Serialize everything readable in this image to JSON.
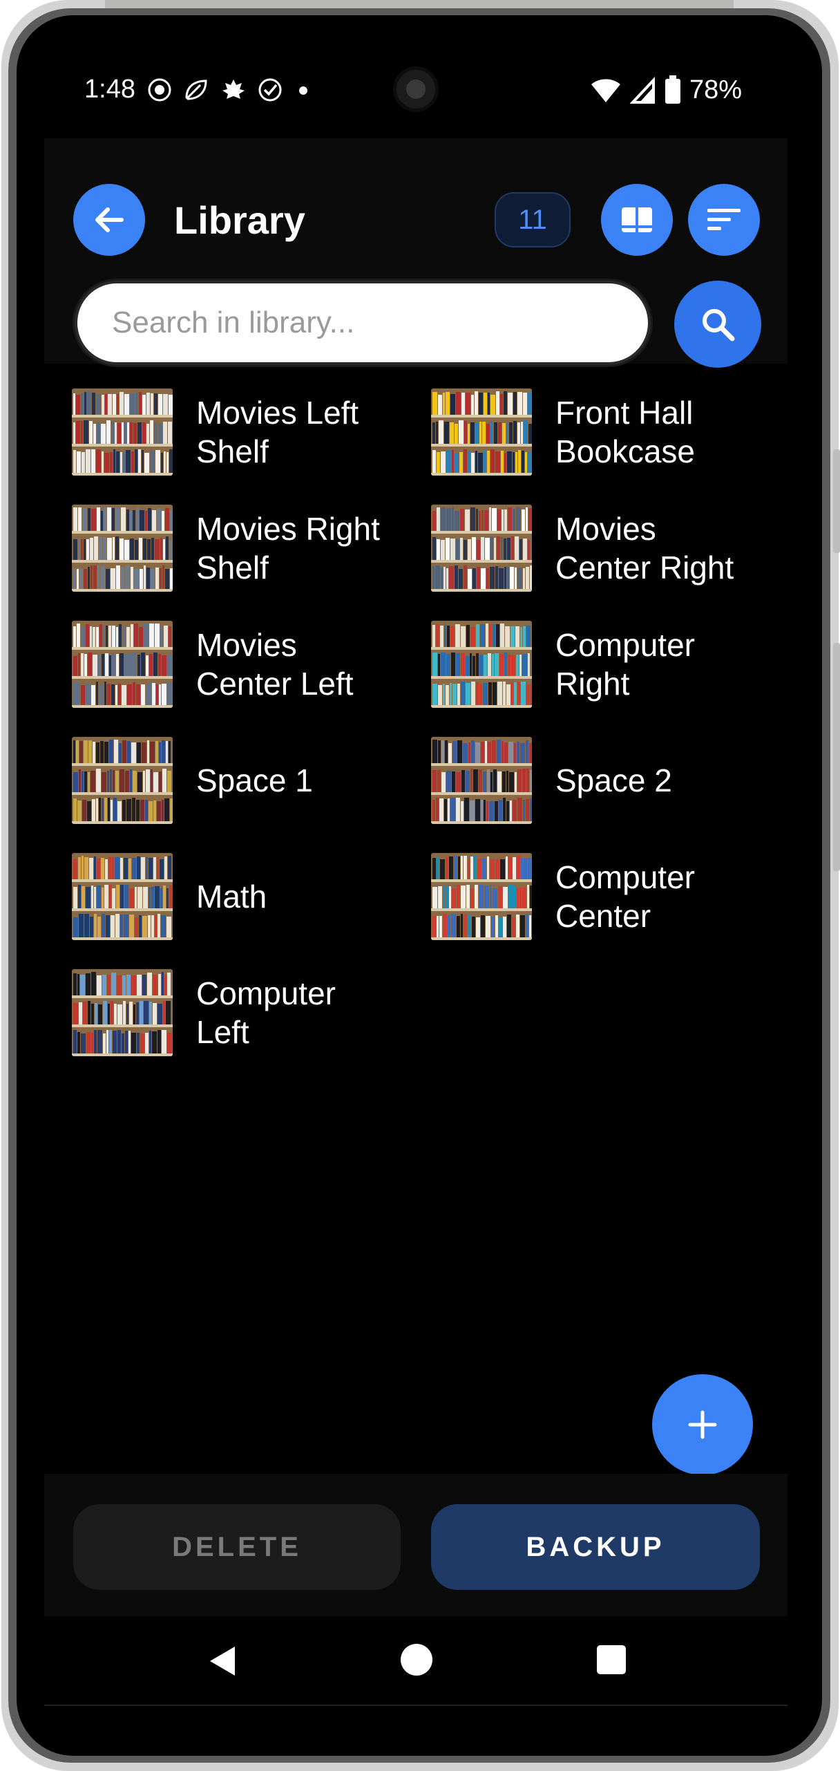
{
  "status_bar": {
    "time": "1:48",
    "battery": "78%"
  },
  "header": {
    "title": "Library",
    "count": "11"
  },
  "search": {
    "placeholder": "Search in library..."
  },
  "shelves": [
    {
      "label": "Movies Left Shelf",
      "palette": [
        "#e8e3d8",
        "#23324f",
        "#b52a2a",
        "#f2f2f2",
        "#5b6a80"
      ]
    },
    {
      "label": "Front Hall Bookcase",
      "palette": [
        "#f1efe8",
        "#1d2a44",
        "#b32d2d",
        "#2a7fb6",
        "#f0c419"
      ]
    },
    {
      "label": "Movies Right Shelf",
      "palette": [
        "#ebe6dc",
        "#25304a",
        "#a8332d",
        "#f4f4f4",
        "#6c7a90"
      ]
    },
    {
      "label": "Movies Center Right",
      "palette": [
        "#e6e1d6",
        "#2b3550",
        "#b03434",
        "#ffffff",
        "#526377"
      ]
    },
    {
      "label": "Movies Center Left",
      "palette": [
        "#e9e4da",
        "#22304b",
        "#ad2f2f",
        "#f3f3f3",
        "#627085"
      ]
    },
    {
      "label": "Computer Right",
      "palette": [
        "#2a6bb0",
        "#d4382c",
        "#1e1e1e",
        "#3fb8c8",
        "#e6e0cf"
      ]
    },
    {
      "label": "Space 1",
      "palette": [
        "#1f1f26",
        "#e9e6df",
        "#2d4d8f",
        "#c9a646",
        "#7b2d2d"
      ]
    },
    {
      "label": "Space 2",
      "palette": [
        "#eae8e2",
        "#1c1c24",
        "#3a5da0",
        "#b2362f",
        "#8a8f99"
      ]
    },
    {
      "label": "Math",
      "palette": [
        "#2e5fa5",
        "#e8e2d1",
        "#c43a2e",
        "#1f3d6b",
        "#d7a64a"
      ]
    },
    {
      "label": "Computer Center",
      "palette": [
        "#f0ede4",
        "#1a8fb3",
        "#d23b2f",
        "#1e1e1e",
        "#3b6cc0"
      ]
    },
    {
      "label": "Computer Left",
      "palette": [
        "#ece7dc",
        "#2a3c6e",
        "#c5382e",
        "#6f9fd0",
        "#1c1c1c"
      ]
    }
  ],
  "actions": {
    "delete_label": "DELETE",
    "backup_label": "BACKUP"
  },
  "colors": {
    "accent": "#3b82f6",
    "backup_bg": "#1f3a66",
    "badge_text": "#4f8ff7"
  },
  "icons": {
    "back": "arrow-left-icon",
    "view": "book-open-icon",
    "sort": "sort-lines-icon",
    "search": "search-icon",
    "add": "plus-icon"
  }
}
